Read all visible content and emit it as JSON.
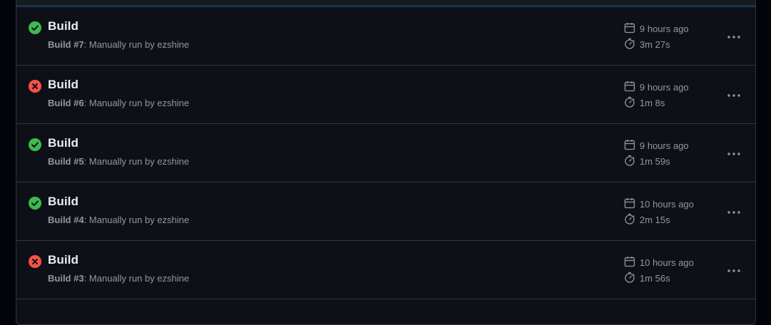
{
  "runs": [
    {
      "status": "success",
      "title": "Build",
      "run_number": "Build #7",
      "trigger": ": Manually run by ezshine",
      "started": "9 hours ago",
      "duration": "3m 27s"
    },
    {
      "status": "failure",
      "title": "Build",
      "run_number": "Build #6",
      "trigger": ": Manually run by ezshine",
      "started": "9 hours ago",
      "duration": "1m 8s"
    },
    {
      "status": "success",
      "title": "Build",
      "run_number": "Build #5",
      "trigger": ": Manually run by ezshine",
      "started": "9 hours ago",
      "duration": "1m 59s"
    },
    {
      "status": "success",
      "title": "Build",
      "run_number": "Build #4",
      "trigger": ": Manually run by ezshine",
      "started": "10 hours ago",
      "duration": "2m 15s"
    },
    {
      "status": "failure",
      "title": "Build",
      "run_number": "Build #3",
      "trigger": ": Manually run by ezshine",
      "started": "10 hours ago",
      "duration": "1m 56s"
    }
  ],
  "colors": {
    "success": "#3fb950",
    "failure": "#f85149",
    "muted": "#9198a1",
    "background": "#0d1117",
    "border": "#30363d"
  },
  "icons": {
    "success": "check-circle-fill-icon",
    "failure": "x-circle-fill-icon",
    "started": "calendar-icon",
    "duration": "stopwatch-icon",
    "menu": "kebab-horizontal-icon"
  }
}
